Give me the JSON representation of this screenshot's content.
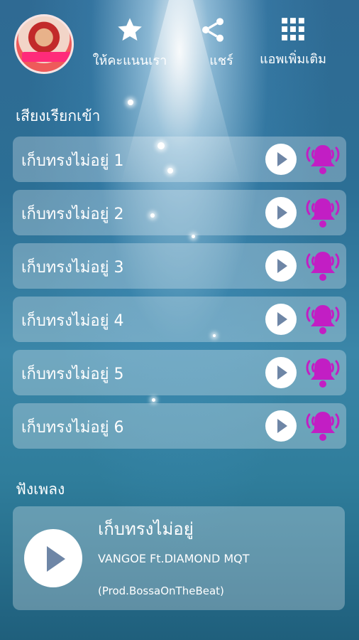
{
  "header": {
    "rate_label": "ให้คะแนนเรา",
    "share_label": "แชร์",
    "more_apps_label": "แอพเพิ่มเติม"
  },
  "ringtones": {
    "section_title": "เสียงเรียกเข้า",
    "items": [
      {
        "title": "เก็บทรงไม่อยู่ 1"
      },
      {
        "title": "เก็บทรงไม่อยู่ 2"
      },
      {
        "title": "เก็บทรงไม่อยู่ 3"
      },
      {
        "title": "เก็บทรงไม่อยู่ 4"
      },
      {
        "title": "เก็บทรงไม่อยู่ 5"
      },
      {
        "title": "เก็บทรงไม่อยู่ 6"
      }
    ]
  },
  "listen": {
    "section_title": "ฟังเพลง",
    "song_title": "เก็บทรงไม่อยู่",
    "artist": "VANGOE Ft.DIAMOND MQT",
    "producer": "(Prod.BossaOnTheBeat)"
  },
  "icons": {
    "rate": "star-icon",
    "share": "share-icon",
    "more_apps": "grid-icon",
    "play": "play-icon",
    "set_ringtone": "ringing-bell-icon"
  },
  "colors": {
    "bell_magenta": "#c21ec4",
    "play_triangle": "#6e86a6"
  }
}
